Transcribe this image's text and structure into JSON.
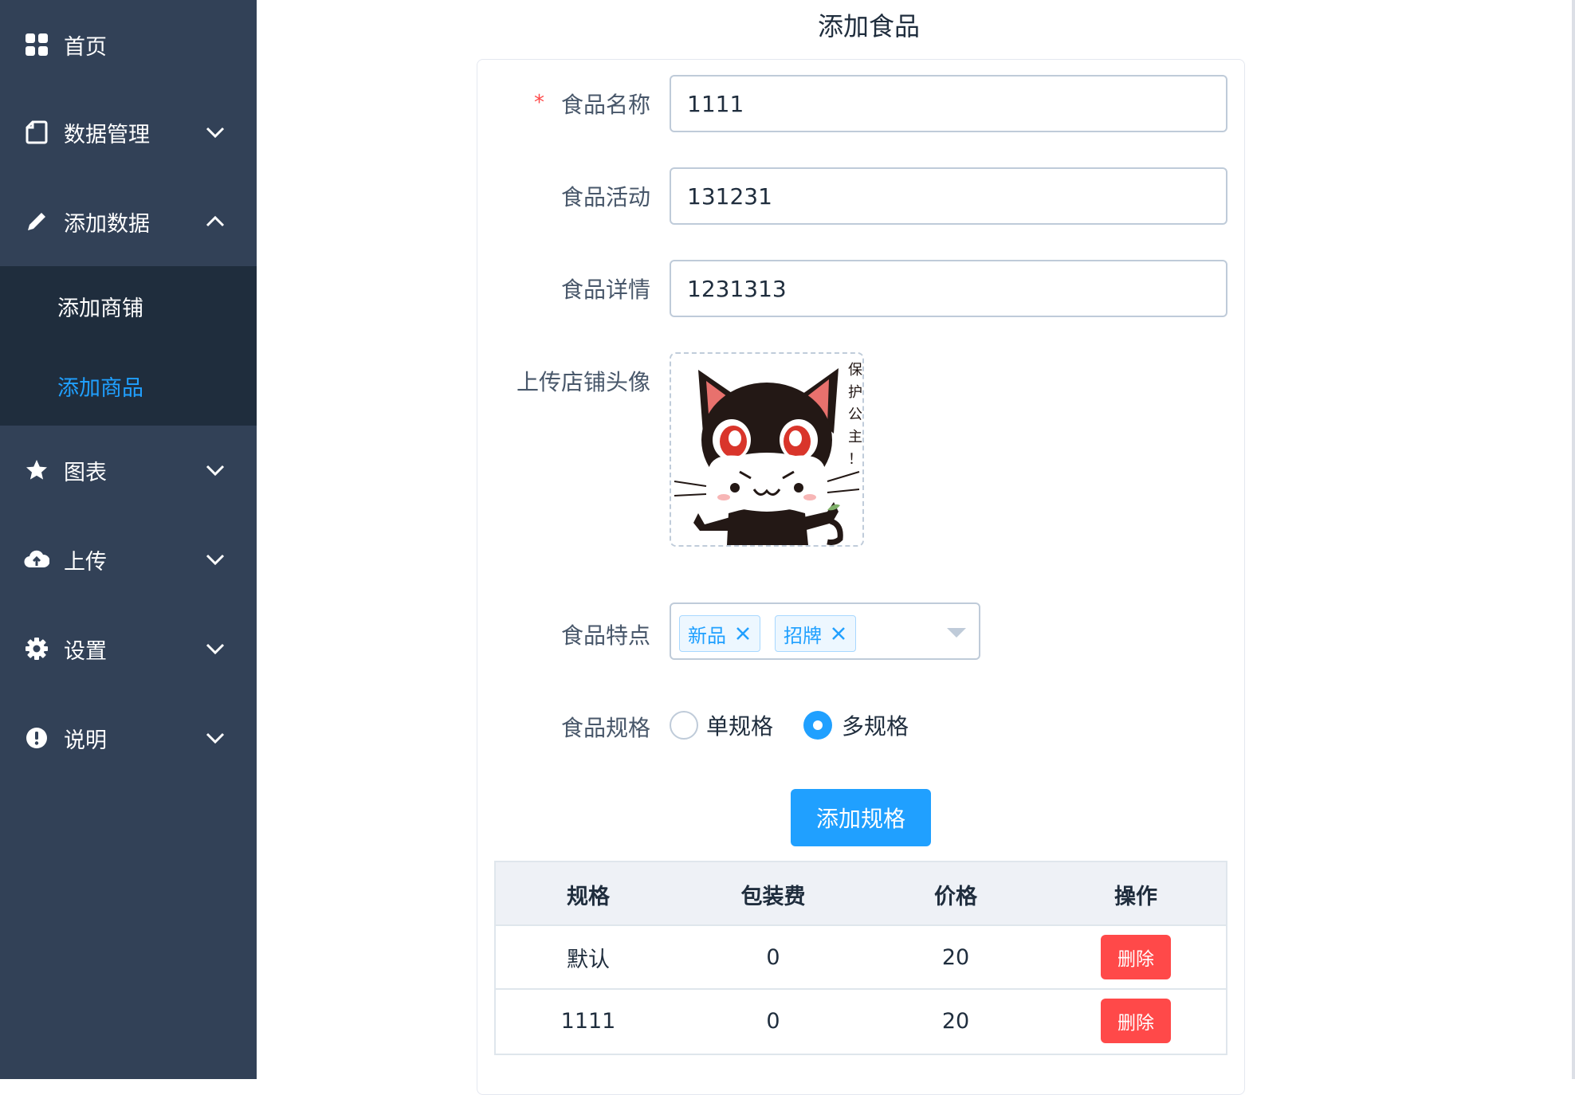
{
  "sidebar": {
    "menu": [
      {
        "label": "首页",
        "icon": "grid-icon"
      },
      {
        "label": "数据管理",
        "icon": "document-icon"
      },
      {
        "label": "添加数据",
        "icon": "pencil-icon"
      },
      {
        "label": "图表",
        "icon": "star-icon"
      },
      {
        "label": "上传",
        "icon": "cloud-upload-icon"
      },
      {
        "label": "设置",
        "icon": "gear-icon"
      },
      {
        "label": "说明",
        "icon": "info-icon"
      }
    ],
    "submenu": [
      {
        "label": "添加商铺"
      },
      {
        "label": "添加商品",
        "active": true
      }
    ]
  },
  "page": {
    "title": "添加食品"
  },
  "form": {
    "name_label": "食品名称",
    "name_required_mark": "*",
    "name_value": "1111",
    "activity_label": "食品活动",
    "activity_value": "131231",
    "detail_label": "食品详情",
    "detail_value": "1231313",
    "avatar_label": "上传店铺头像",
    "avatar_caption": "保护公主！",
    "features_label": "食品特点",
    "features_tags": [
      "新品",
      "招牌"
    ],
    "spec_label": "食品规格",
    "spec_options": [
      "单规格",
      "多规格"
    ],
    "spec_selected": "多规格",
    "add_spec_button": "添加规格"
  },
  "spec_table": {
    "headers": [
      "规格",
      "包装费",
      "价格",
      "操作"
    ],
    "rows": [
      {
        "spec": "默认",
        "packing_fee": "0",
        "price": "20",
        "action": "删除"
      },
      {
        "spec": "1111",
        "packing_fee": "0",
        "price": "20",
        "action": "删除"
      }
    ]
  },
  "colors": {
    "sidebar_bg": "#324157",
    "submenu_bg": "#1f2d3d",
    "accent": "#20a0ff",
    "danger": "#ff4949"
  }
}
